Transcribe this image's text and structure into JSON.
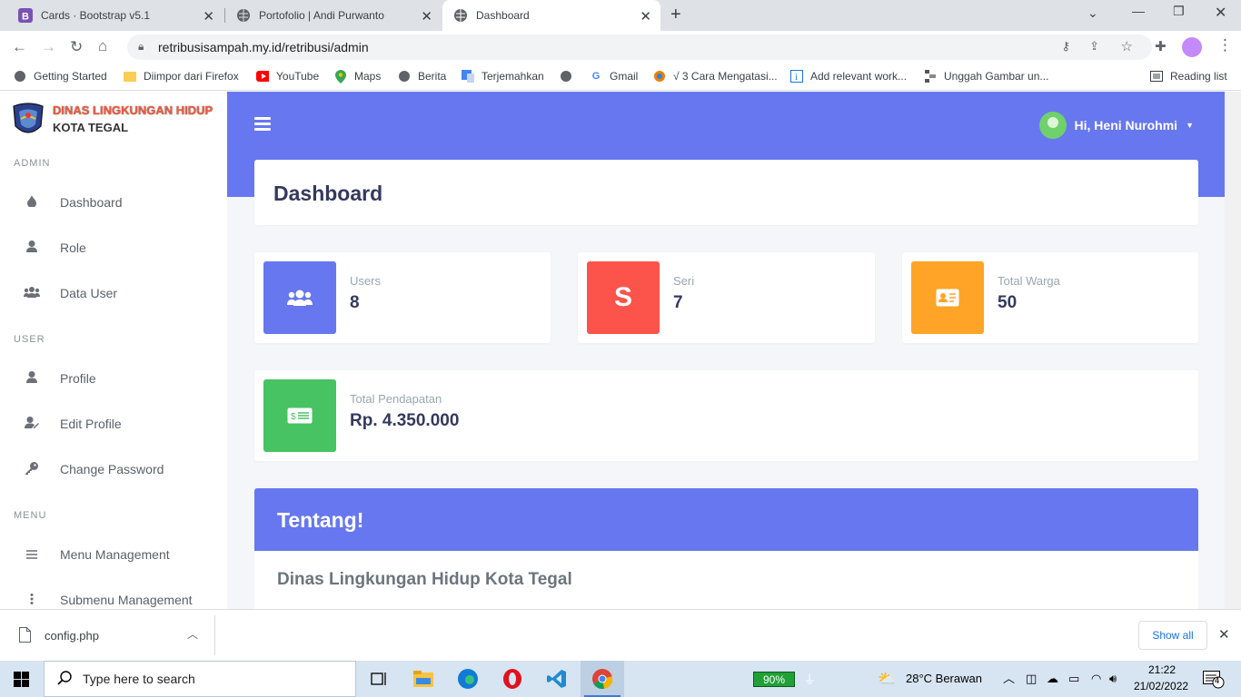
{
  "browser": {
    "tabs": [
      {
        "title": "Cards · Bootstrap v5.1",
        "icon": "bootstrap-icon"
      },
      {
        "title": "Portofolio | Andi Purwanto",
        "icon": "globe-icon"
      },
      {
        "title": "Dashboard",
        "icon": "globe-icon",
        "active": true
      }
    ],
    "url": "retribusisampah.my.id/retribusi/admin",
    "bookmarks": [
      {
        "label": "Getting Started",
        "icon": "globe-icon"
      },
      {
        "label": "Diimpor dari Firefox",
        "icon": "folder-icon"
      },
      {
        "label": "YouTube",
        "icon": "youtube-icon"
      },
      {
        "label": "Maps",
        "icon": "maps-icon"
      },
      {
        "label": "Berita",
        "icon": "globe-icon"
      },
      {
        "label": "Terjemahkan",
        "icon": "translate-icon"
      },
      {
        "label": "",
        "icon": "globe-icon"
      },
      {
        "label": "Gmail",
        "icon": "google-icon"
      },
      {
        "label": "√ 3 Cara Mengatasi...",
        "icon": "pinwheel-icon"
      },
      {
        "label": "Add relevant work...",
        "icon": "info-icon"
      },
      {
        "label": "Unggah Gambar un...",
        "icon": "upload-icon"
      }
    ],
    "reading_list": "Reading list"
  },
  "sidebar": {
    "brand_line1": "DINAS LINGKUNGAN HIDUP",
    "brand_line2": "KOTA TEGAL",
    "sections": [
      {
        "heading": "ADMIN",
        "items": [
          {
            "label": "Dashboard",
            "icon": "fire-icon"
          },
          {
            "label": "Role",
            "icon": "user-icon"
          },
          {
            "label": "Data User",
            "icon": "users-icon"
          }
        ]
      },
      {
        "heading": "USER",
        "items": [
          {
            "label": "Profile",
            "icon": "user-icon"
          },
          {
            "label": "Edit Profile",
            "icon": "user-edit-icon"
          },
          {
            "label": "Change Password",
            "icon": "key-icon"
          }
        ]
      },
      {
        "heading": "MENU",
        "items": [
          {
            "label": "Menu Management",
            "icon": "bars-icon"
          },
          {
            "label": "Submenu Management",
            "icon": "ellipsis-vertical-icon"
          }
        ]
      }
    ]
  },
  "topbar": {
    "greeting": "Hi, Heni Nurohmi"
  },
  "main": {
    "title": "Dashboard",
    "stats": [
      {
        "label": "Users",
        "value": "8",
        "color": "#6777ef",
        "icon": "users-icon"
      },
      {
        "label": "Seri",
        "value": "7",
        "color": "#fc544b",
        "icon_text": "S"
      },
      {
        "label": "Total Warga",
        "value": "50",
        "color": "#ffa426",
        "icon": "id-card-icon"
      },
      {
        "label": "Total Pendapatan",
        "value": "Rp. 4.350.000",
        "color": "#47c363",
        "icon": "money-icon"
      }
    ],
    "about_title": "Tentang!",
    "about_subtitle": "Dinas Lingkungan Hidup Kota Tegal"
  },
  "downloads": {
    "file": "config.php",
    "show_all": "Show all"
  },
  "taskbar": {
    "search_placeholder": "Type here to search",
    "battery": "90%",
    "weather": "28°C  Berawan",
    "time": "21:22",
    "date": "21/02/2022",
    "notifications": "4"
  }
}
